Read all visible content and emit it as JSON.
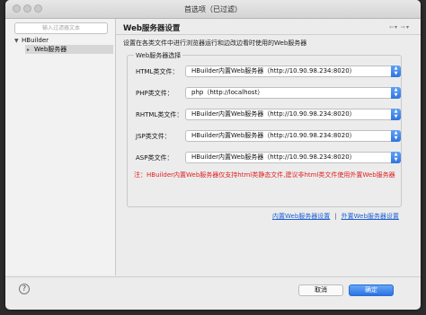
{
  "window": {
    "title": "首选项（已过滤）"
  },
  "filter": {
    "placeholder": "输入过滤器文本"
  },
  "tree": [
    {
      "label": "HBuilder",
      "expanded": true
    },
    {
      "label": "Web服务器",
      "selected": true
    }
  ],
  "page": {
    "title": "Web服务器设置",
    "nav_icons": [
      "back-arrow-icon",
      "forward-arrow-icon"
    ],
    "description": "设置在各类文件中进行浏览器运行和边改边看时使用的Web服务器",
    "group_title": "Web服务器选择",
    "rows": [
      {
        "label": "HTML类文件：",
        "value": "HBuilder内置Web服务器（http://10.90.98.234:8020）"
      },
      {
        "label": "PHP类文件：",
        "value": "php（http://localhost）"
      },
      {
        "label": "RHTML类文件：",
        "value": "HBuilder内置Web服务器（http://10.90.98.234:8020）"
      },
      {
        "label": "JSP类文件：",
        "value": "HBuilder内置Web服务器（http://10.90.98.234:8020）"
      },
      {
        "label": "ASP类文件：",
        "value": "HBuilder内置Web服务器（http://10.90.98.234:8020）"
      }
    ],
    "note": "注：HBuilder内置Web服务器仅支持html类静态文件,建议非html类文件使用外置Web服务器",
    "links": {
      "builtin": "内置Web服务器设置",
      "separator": "|",
      "external": "外置Web服务器设置"
    }
  },
  "footer": {
    "help": "?",
    "cancel": "取消",
    "ok": "确定"
  },
  "colors": {
    "accent": "#2f74e0",
    "note": "#e02020",
    "link": "#1f5fd1"
  }
}
